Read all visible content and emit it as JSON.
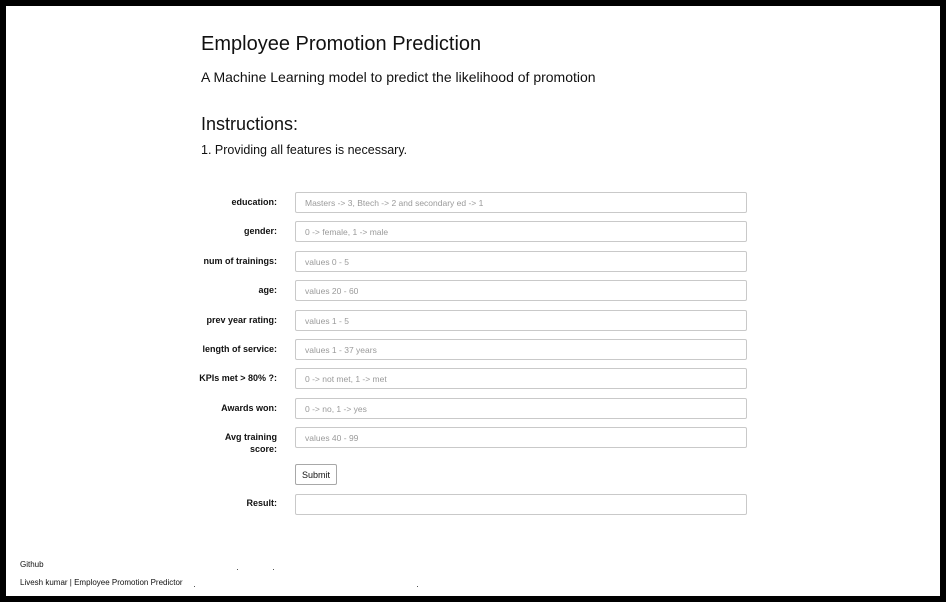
{
  "header": {
    "title": "Employee Promotion Prediction",
    "subtitle": "A Machine Learning model to predict the likelihood of promotion"
  },
  "instructions": {
    "heading": "Instructions:",
    "items": [
      "1. Providing all features is necessary."
    ]
  },
  "form": {
    "fields": [
      {
        "label": "education:",
        "placeholder": "Masters -> 3, Btech -> 2 and secondary ed -> 1",
        "value": ""
      },
      {
        "label": "gender:",
        "placeholder": "0 -> female, 1 -> male",
        "value": ""
      },
      {
        "label": "num of trainings:",
        "placeholder": "values 0 - 5",
        "value": ""
      },
      {
        "label": "age:",
        "placeholder": "values 20 - 60",
        "value": ""
      },
      {
        "label": "prev year rating:",
        "placeholder": "values 1 - 5",
        "value": ""
      },
      {
        "label": "length of service:",
        "placeholder": "values 1 - 37 years",
        "value": ""
      },
      {
        "label": "KPIs met > 80% ?:",
        "placeholder": "0 -> not met, 1 -> met",
        "value": ""
      },
      {
        "label": "Awards won:",
        "placeholder": "0 -> no, 1 -> yes",
        "value": ""
      },
      {
        "label": "Avg training score:",
        "placeholder": "values 40 - 99",
        "value": ""
      }
    ],
    "submit_label": "Submit",
    "result_label": "Result:",
    "result_value": ""
  },
  "footer": {
    "link_label": "Github",
    "credit": "Livesh kumar | Employee Promotion Predictor"
  }
}
